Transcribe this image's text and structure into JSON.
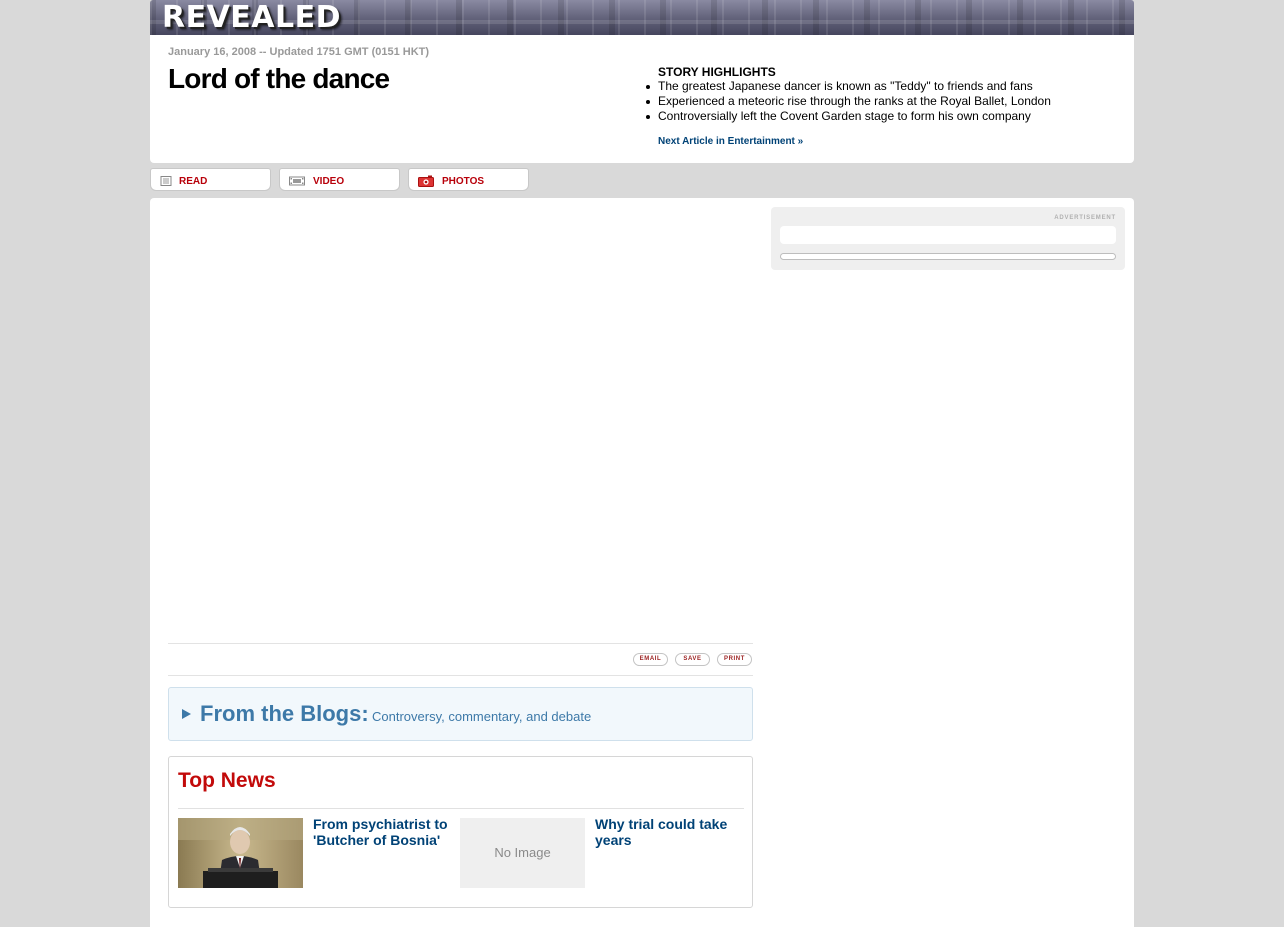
{
  "banner": {
    "logo_text": "REVEALED"
  },
  "article": {
    "dateline": "January 16, 2008 -- Updated 1751 GMT (0151 HKT)",
    "headline": "Lord of the dance"
  },
  "highlights": {
    "title": "STORY HIGHLIGHTS",
    "items": [
      "The greatest Japanese dancer is known as \"Teddy\" to friends and fans",
      "Experienced a meteoric rise through the ranks at the Royal Ballet, London",
      "Controversially left the Covent Garden stage to form his own company"
    ],
    "next_link": "Next Article in Entertainment »"
  },
  "tabs": [
    {
      "label": "READ",
      "icon": "document-icon"
    },
    {
      "label": "VIDEO",
      "icon": "video-icon"
    },
    {
      "label": "PHOTOS",
      "icon": "camera-icon"
    }
  ],
  "advertisement": {
    "label": "ADVERTISEMENT"
  },
  "tools": {
    "email": "EMAIL",
    "save": "SAVE",
    "print": "PRINT"
  },
  "blogs": {
    "title": "From the Blogs:",
    "subtitle": "Controversy, commentary, and debate"
  },
  "top_news": {
    "title": "Top News",
    "items": [
      {
        "headline": "From psychiatrist to 'Butcher of Bosnia'",
        "thumbnail": "photo"
      },
      {
        "headline": "Why trial could take years",
        "thumbnail": "No Image"
      }
    ]
  },
  "colors": {
    "tab_label": "#b8000a",
    "link": "#004276",
    "blogs": "#3d79a8",
    "top_news": "#c20a0a"
  }
}
